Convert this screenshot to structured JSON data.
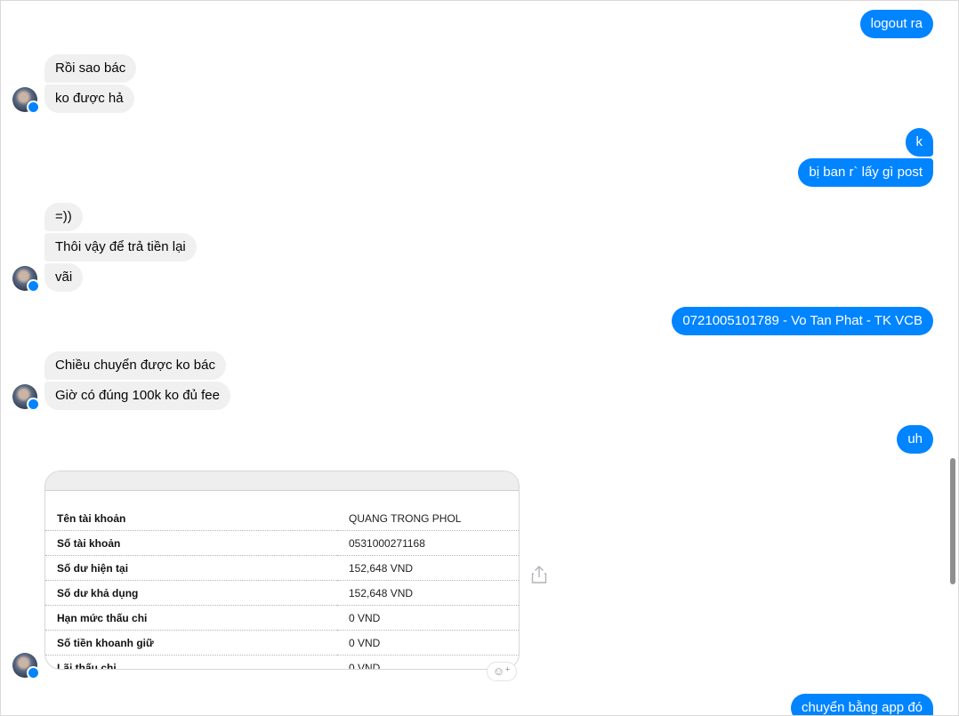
{
  "messages": {
    "m1": "logout ra",
    "m2": "Rồi sao bác",
    "m3": "ko được hả",
    "m4": "k",
    "m5": "bị ban r` lấy gì post",
    "m6": "=))",
    "m7": "Thôi vậy để trả tiền lại",
    "m8": "vãi",
    "m9": "0721005101789 - Vo Tan Phat - TK VCB",
    "m10": "Chiều chuyển được ko bác",
    "m11": "Giờ có đúng 100k ko đủ fee",
    "m12": "uh",
    "m13": "chuyển bằng app đó"
  },
  "account_card": {
    "rows": [
      {
        "label": "Tên tài khoản",
        "value": "QUANG TRONG PHOL"
      },
      {
        "label": "Số tài khoản",
        "value": "0531000271168"
      },
      {
        "label": "Số dư hiện tại",
        "value": "152,648 VND"
      },
      {
        "label": "Số dư khả dụng",
        "value": "152,648 VND"
      },
      {
        "label": "Hạn mức thấu chi",
        "value": "0 VND"
      },
      {
        "label": "Số tiền khoanh giữ",
        "value": "0 VND"
      },
      {
        "label": "Lãi thấu chi",
        "value": "0 VND"
      }
    ]
  },
  "icons": {
    "share": "share-icon",
    "react": "add-reaction-icon",
    "avatar_badge": "messenger-badge-icon"
  },
  "colors": {
    "outgoing": "#0084ff",
    "incoming": "#f0f0f0"
  }
}
